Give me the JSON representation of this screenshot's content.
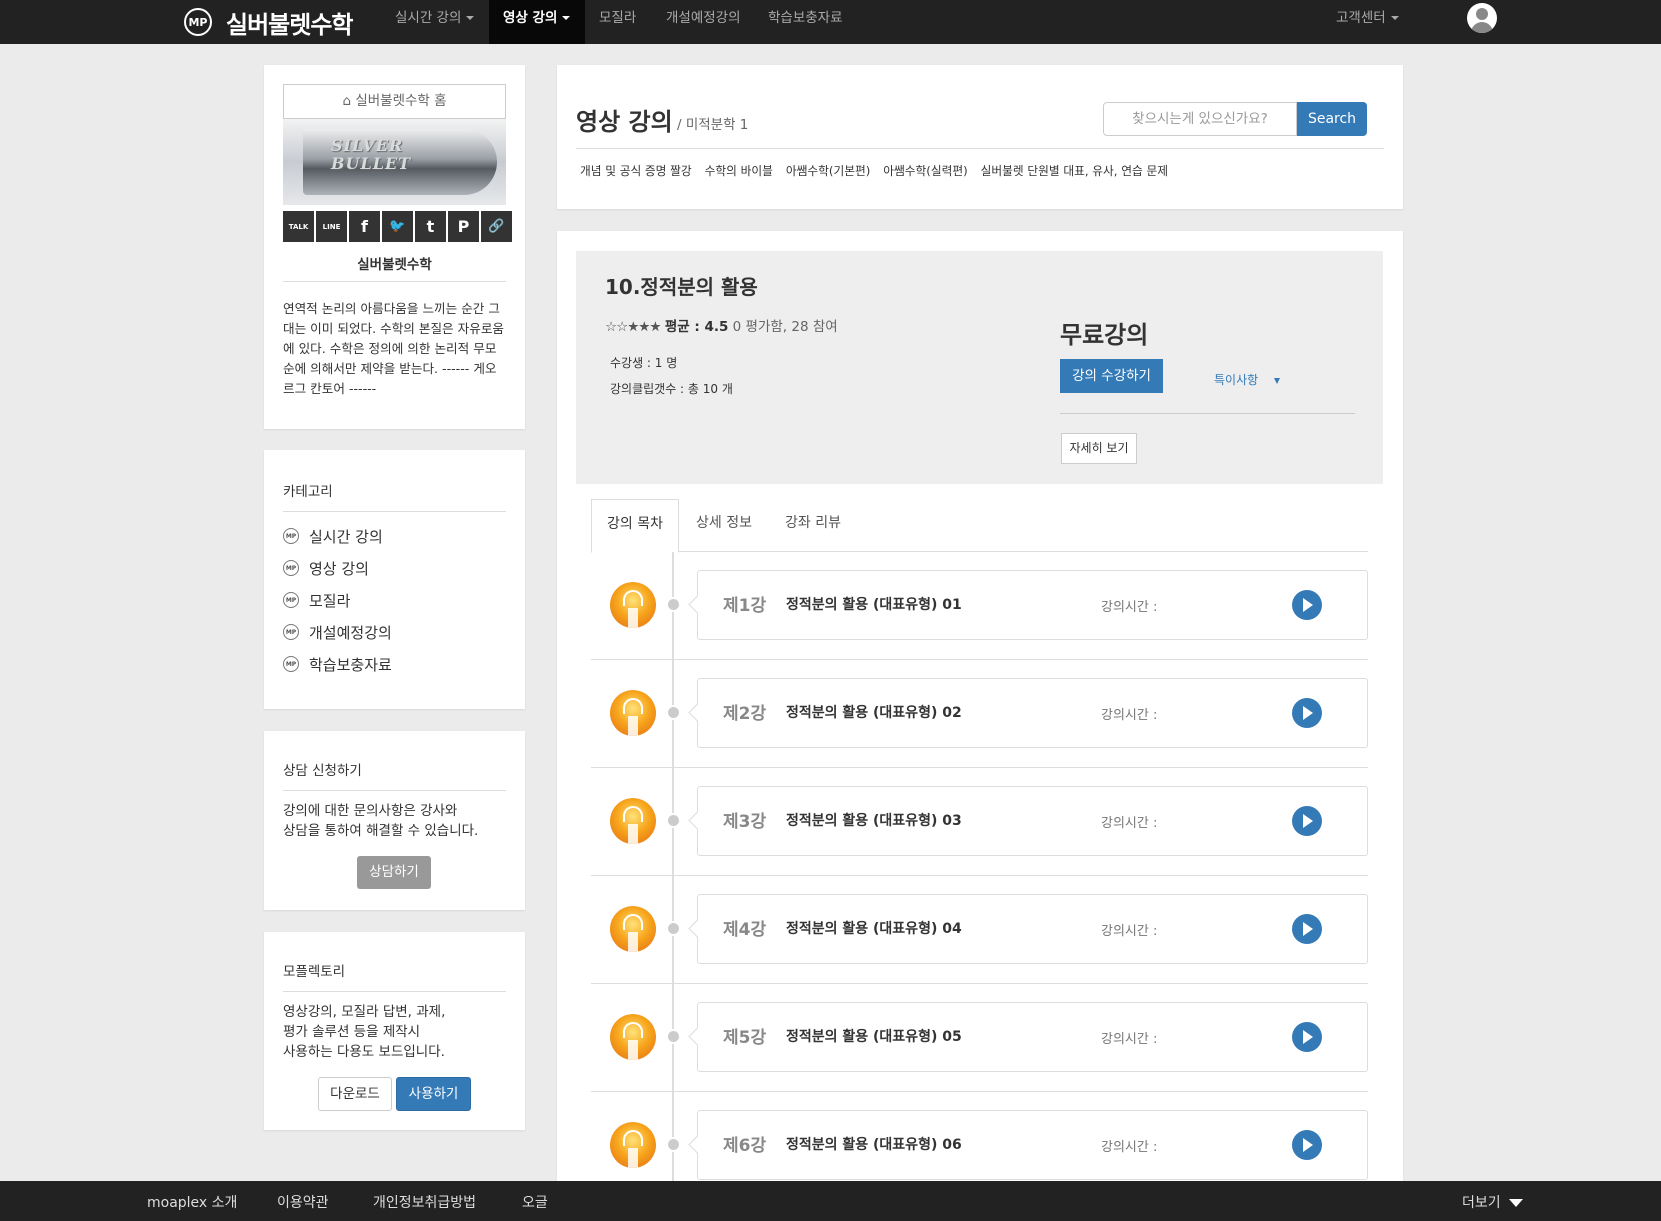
{
  "nav": {
    "logo_text": "MP",
    "brand": "실버불렛수학",
    "items": [
      {
        "label": "실시간 강의",
        "dropdown": true
      },
      {
        "label": "영상 강의",
        "dropdown": true,
        "active": true
      },
      {
        "label": "모질라"
      },
      {
        "label": "개설예정강의"
      },
      {
        "label": "학습보충자료"
      }
    ],
    "support": "고객센터"
  },
  "sidebar": {
    "home_label": "실버불렛수학 홈",
    "banner_text_1": "SILVER",
    "banner_text_2": "BULLET",
    "share_buttons": [
      {
        "icon": "kakaotalk-icon",
        "glyph": "TALK"
      },
      {
        "icon": "line-icon",
        "glyph": "LINE"
      },
      {
        "icon": "facebook-icon",
        "glyph": "f"
      },
      {
        "icon": "twitter-icon",
        "glyph": "🐦"
      },
      {
        "icon": "tumblr-icon",
        "glyph": "t"
      },
      {
        "icon": "pinterest-icon",
        "glyph": "P"
      },
      {
        "icon": "link-icon",
        "glyph": "🔗"
      }
    ],
    "profile_name": "실버불렛수학",
    "profile_desc": "연역적 논리의 아름다움을 느끼는 순간 그대는 이미 되었다. 수학의 본질은 자유로움에 있다. 수학은 정의에 의한 논리적 무모순에 의해서만 제약을 받는다. ------ 게오르그 칸토어 ------",
    "category_title": "카테고리",
    "categories": [
      "실시간 강의",
      "영상 강의",
      "모질라",
      "개설예정강의",
      "학습보충자료"
    ],
    "consult": {
      "title": "상담 신청하기",
      "line1": "강의에 대한 문의사항은 강사와",
      "line2": "상담을 통하여 해결할 수 있습니다.",
      "button": "상담하기"
    },
    "factory": {
      "title": "모플렉토리",
      "line1": "영상강의, 모질라 답변, 과제,",
      "line2": "평가 솔루션 등을 제작시",
      "line3": "사용하는 다용도 보드입니다.",
      "download": "다운로드",
      "use": "사용하기"
    }
  },
  "header": {
    "title": "영상 강의",
    "subtitle": "/ 미적분학 1",
    "search_placeholder": "찾으시는게 있으신가요?",
    "search_button": "Search",
    "links": [
      "개념 및 공식 증명 짤강",
      "수학의 바이블",
      "아쌤수학(기본편)",
      "아쌤수학(실력편)",
      "실버불렛 단원별 대표, 유사, 연습 문제"
    ]
  },
  "course": {
    "title": "10.정적분의 활용",
    "stars": "☆☆★★★",
    "rating_label": "평균 : 4.5",
    "rating_info": "0 평가함, 28 참여",
    "students": "수강생 : 1 명",
    "clips": "강의클립갯수 : 총 10 개",
    "price_label": "무료강의",
    "enroll_button": "강의 수강하기",
    "special_link": "특이사항",
    "detail_button": "자세히 보기"
  },
  "tabs": [
    "강의 목차",
    "상세 정보",
    "강좌 리뷰"
  ],
  "lessons": [
    {
      "num": "제1강",
      "name": "정적분의 활용 (대표유형) 01",
      "time": "강의시간 :"
    },
    {
      "num": "제2강",
      "name": "정적분의 활용 (대표유형) 02",
      "time": "강의시간 :"
    },
    {
      "num": "제3강",
      "name": "정적분의 활용 (대표유형) 03",
      "time": "강의시간 :"
    },
    {
      "num": "제4강",
      "name": "정적분의 활용 (대표유형) 04",
      "time": "강의시간 :"
    },
    {
      "num": "제5강",
      "name": "정적분의 활용 (대표유형) 05",
      "time": "강의시간 :"
    },
    {
      "num": "제6강",
      "name": "정적분의 활용 (대표유형) 06",
      "time": "강의시간 :"
    }
  ],
  "footer": {
    "links": [
      "moaplex 소개",
      "이용약관",
      "개인정보취급방법",
      "오글"
    ],
    "more": "더보기"
  }
}
